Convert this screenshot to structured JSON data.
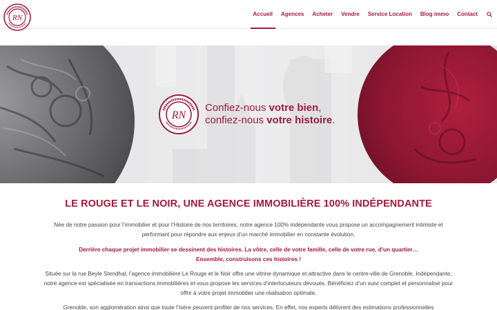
{
  "header": {
    "logo_text": "LE ROUGE ET LE NOIR IMMOBILIER RN",
    "nav": [
      {
        "label": "Accueil",
        "active": true
      },
      {
        "label": "Agences"
      },
      {
        "label": "Acheter"
      },
      {
        "label": "Vendre"
      },
      {
        "label": "Service Location"
      },
      {
        "label": "Blog immo"
      },
      {
        "label": "Contact"
      }
    ],
    "search_icon": "search-icon"
  },
  "hero": {
    "tagline_line1_a": "Confiez-nous ",
    "tagline_line1_b": "votre bien",
    "tagline_line1_c": ",",
    "tagline_line2_a": "confiez-nous ",
    "tagline_line2_b": "votre histoire",
    "tagline_line2_c": ".",
    "brand_color": "#9e1a3c"
  },
  "main": {
    "title": "LE ROUGE ET LE NOIR, UNE AGENCE IMMOBILIÈRE 100% INDÉPENDANTE",
    "paragraph1": "Née de notre passion pour l’immobilier et pour l’Histoire de nos territoires, notre agence 100% indépendante vous propose un accompagnement intimiste et performant pour répondre aux enjeux d’un marché immobilier en constante évolution.",
    "paragraph2_line1": "Derrière chaque projet immobilier se dessinent des histoires. La vôtre, celle de votre famille, celle de votre rue, d’un quartier…",
    "paragraph2_line2": "Ensemble, construisons ces histoires !",
    "paragraph3": "Située sur la rue Beyle Stendhal, l’agence immobilière Le Rouge et le Noir offre une vitrine dynamique et attractive dans le centre-ville de Grenoble. Indépendante, notre agence est spécialisée en transactions immobilières et vous propose les services d’interlocuteurs dévoués. Bénéficiez d’un suivi complet et personnalisé pour offrir à votre projet immobilier une réalisation optimale.",
    "paragraph4": "Grenoble, son agglomération ainsi que toute l’Isère peuvent profiter de nos services. En effet, nos experts délivrent des estimations professionnelles"
  },
  "colors": {
    "accent": "#a5193b"
  }
}
